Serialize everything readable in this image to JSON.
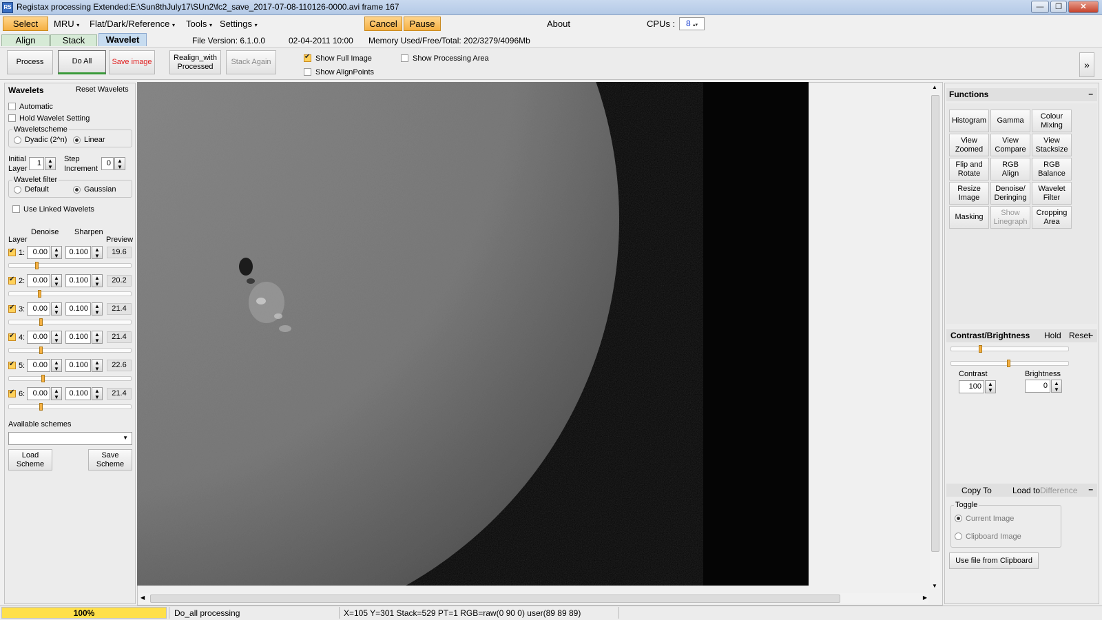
{
  "window": {
    "title": "Registax processing Extended:E:\\Sun8thJuly17\\SUn2\\fc2_save_2017-07-08-110126-0000.avi frame 167",
    "min": "—",
    "max": "❐",
    "close": "✕"
  },
  "menu": {
    "select": "Select",
    "mru": "MRU",
    "flat": "Flat/Dark/Reference",
    "tools": "Tools",
    "settings": "Settings",
    "cancel": "Cancel",
    "pause": "Pause",
    "about": "About",
    "cpus_label": "CPUs :",
    "cpus_value": "8"
  },
  "tabs": {
    "align": "Align",
    "stack": "Stack",
    "wavelet": "Wavelet"
  },
  "info": {
    "file_version": "File Version: 6.1.0.0",
    "date": "02-04-2011 10:00",
    "memory": "Memory Used/Free/Total: 202/3279/4096Mb"
  },
  "toolbar": {
    "process": "Process",
    "do_all": "Do All",
    "save_image": "Save image",
    "realign_1": "Realign_with",
    "realign_2": "Processed",
    "stack_again": "Stack Again",
    "show_full_image": "Show Full Image",
    "show_processing_area": "Show Processing Area",
    "show_alignpoints": "Show AlignPoints",
    "expand": "»"
  },
  "wavelets": {
    "header": "Wavelets",
    "reset": "Reset Wavelets",
    "automatic": "Automatic",
    "hold": "Hold Wavelet Setting",
    "scheme_title": "Waveletscheme",
    "dyadic": "Dyadic (2^n)",
    "linear": "Linear",
    "initial_1": "Initial",
    "initial_2": "Layer",
    "initial_value": "1",
    "step_1": "Step",
    "step_2": "Increment",
    "step_value": "0",
    "filter_title": "Wavelet filter",
    "default": "Default",
    "gaussian": "Gaussian",
    "linked": "Use Linked Wavelets",
    "col_layer": "Layer",
    "col_denoise": "Denoise",
    "col_sharpen": "Sharpen",
    "col_preview": "Preview",
    "layers": [
      {
        "n": "1",
        "denoise": "0.00",
        "sharpen": "0.100",
        "preview": "19.6",
        "slider": 0.22
      },
      {
        "n": "2",
        "denoise": "0.00",
        "sharpen": "0.100",
        "preview": "20.2",
        "slider": 0.24
      },
      {
        "n": "3",
        "denoise": "0.00",
        "sharpen": "0.100",
        "preview": "21.4",
        "slider": 0.25
      },
      {
        "n": "4",
        "denoise": "0.00",
        "sharpen": "0.100",
        "preview": "21.4",
        "slider": 0.25
      },
      {
        "n": "5",
        "denoise": "0.00",
        "sharpen": "0.100",
        "preview": "22.6",
        "slider": 0.27
      },
      {
        "n": "6",
        "denoise": "0.00",
        "sharpen": "0.100",
        "preview": "21.4",
        "slider": 0.25
      }
    ],
    "available": "Available schemes",
    "load_1": "Load",
    "load_2": "Scheme",
    "save_1": "Save",
    "save_2": "Scheme"
  },
  "functions": {
    "header": "Functions",
    "collapse": "–",
    "buttons": [
      [
        "Histogram"
      ],
      [
        "Gamma"
      ],
      [
        "Colour",
        "Mixing"
      ],
      [
        "View",
        "Zoomed"
      ],
      [
        "View",
        "Compare"
      ],
      [
        "View",
        "Stacksize"
      ],
      [
        "Flip and",
        "Rotate"
      ],
      [
        "RGB",
        "Align"
      ],
      [
        "RGB",
        "Balance"
      ],
      [
        "Resize",
        "Image"
      ],
      [
        "Denoise/",
        "Deringing"
      ],
      [
        "Wavelet",
        "Filter"
      ],
      [
        "Masking"
      ],
      [
        "Show",
        "Linegraph"
      ],
      [
        "Cropping",
        "Area"
      ]
    ]
  },
  "contrast": {
    "header": "Contrast/Brightness",
    "hold": "Hold",
    "reset": "Reset",
    "collapse": "–",
    "contrast_label": "Contrast",
    "contrast_value": "100",
    "brightness_label": "Brightness",
    "brightness_value": "0",
    "contrast_slider": 0.24,
    "brightness_slider": 0.49
  },
  "copy": {
    "copy_to": "Copy To",
    "load_to": "Load to",
    "difference": "Difference",
    "collapse": "–",
    "toggle": "Toggle",
    "current": "Current Image",
    "clipboard": "Clipboard Image",
    "use_file": "Use file from Clipboard"
  },
  "status": {
    "progress": "100%",
    "progress_value": 1.0,
    "message": "Do_all processing",
    "readout": "X=105 Y=301 Stack=529 PT=1 RGB=raw(0 90 0) user(89 89 89)"
  },
  "colors": {
    "accent": "#f5b042",
    "tab_active": "#c7dcf0",
    "tab": "#d6ead6",
    "progress": "#ffe04a"
  }
}
